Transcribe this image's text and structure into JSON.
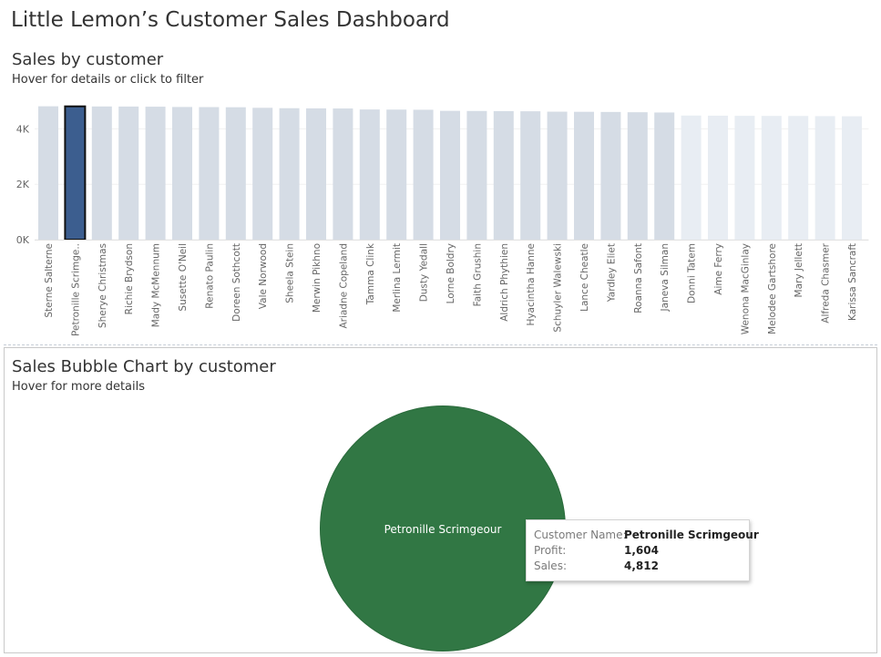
{
  "dashboard": {
    "title": "Little Lemon’s Customer Sales Dashboard"
  },
  "bar_panel": {
    "title": "Sales by customer",
    "subtitle": "Hover for details or click to filter"
  },
  "bubble_panel": {
    "title": "Sales Bubble Chart by customer",
    "subtitle": "Hover for more details",
    "bubble_label": "Petronille Scrimgeour",
    "tooltip": {
      "customer_key": "Customer Name:",
      "customer_value": "Petronille Scrimgeour",
      "profit_key": "Profit:",
      "profit_value": "1,604",
      "sales_key": "Sales:",
      "sales_value": "4,812"
    }
  },
  "colors": {
    "bar_dark": "#d5dce5",
    "bar_light": "#e8edf3",
    "bar_selected": "#3c5e8f",
    "bar_selected_outline": "#111111",
    "bubble": "#317744",
    "axis_text": "#666666"
  },
  "chart_data": [
    {
      "type": "bar",
      "title": "Sales by customer",
      "xlabel": "",
      "ylabel": "",
      "ylim": [
        0,
        5000
      ],
      "ytick_labels": [
        "0K",
        "2K",
        "4K"
      ],
      "ytick_values": [
        0,
        2000,
        4000
      ],
      "selected_category": "Petronille Scrimgeour",
      "selected_tick_label": "Petronille Scrimge..",
      "categories": [
        "Sterne Salterne",
        "Petronille Scrimgeour",
        "Sherye Christmas",
        "Richie Brydson",
        "Mady McMennum",
        "Susette O'Neil",
        "Renato Paulin",
        "Doreen Sothcott",
        "Vale Norwood",
        "Sheela Stein",
        "Merwin Pikhno",
        "Ariadne Copeland",
        "Tamma Clink",
        "Merlina Lermit",
        "Dusty Yedall",
        "Lorne Boldry",
        "Faith Grushin",
        "Aldrich Phythien",
        "Hyacintha Hanne",
        "Schuyler Walewski",
        "Lance Cheatle",
        "Yardley Eliet",
        "Roanna Safont",
        "Janeva Silman",
        "Donni Tatem",
        "Aime Ferry",
        "Wenona MacGinlay",
        "Melodee Gartshore",
        "Mary Jellett",
        "Alfreda Chasmer",
        "Karissa Sancraft"
      ],
      "values": [
        4815,
        4812,
        4808,
        4805,
        4800,
        4790,
        4785,
        4780,
        4760,
        4745,
        4740,
        4735,
        4700,
        4695,
        4690,
        4650,
        4645,
        4640,
        4635,
        4620,
        4615,
        4610,
        4600,
        4590,
        4480,
        4475,
        4470,
        4468,
        4465,
        4460,
        4455
      ]
    },
    {
      "type": "scatter",
      "title": "Sales Bubble Chart by customer",
      "points": [
        {
          "label": "Petronille Scrimgeour",
          "sales": 4812,
          "profit": 1604
        }
      ]
    }
  ]
}
